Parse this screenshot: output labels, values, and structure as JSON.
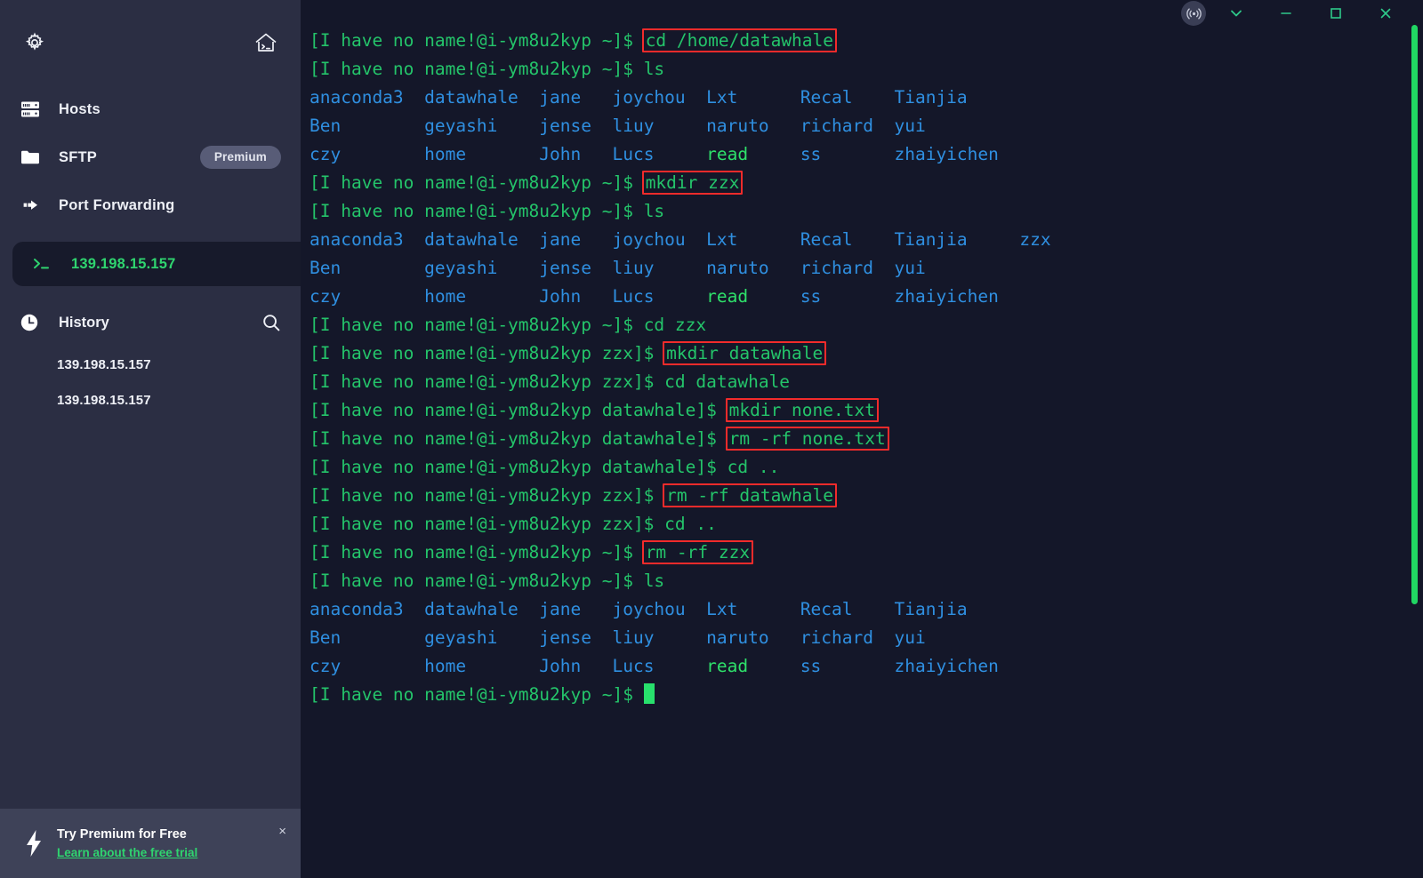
{
  "sidebar": {
    "top_icons": [
      {
        "name": "settings-gear-icon",
        "label": "Settings"
      },
      {
        "name": "home-terminal-icon",
        "label": "Home"
      }
    ],
    "items": [
      {
        "icon": "server-icon",
        "label": "Hosts",
        "badge": ""
      },
      {
        "icon": "folder-icon",
        "label": "SFTP",
        "badge": "Premium"
      },
      {
        "icon": "port-forwarding-icon",
        "label": "Port Forwarding",
        "badge": ""
      }
    ],
    "active_session": {
      "icon": "terminal-prompt-icon",
      "label": "139.198.15.157"
    },
    "history": {
      "icon": "clock-icon",
      "label": "History",
      "search_icon": "search-icon",
      "entries": [
        "139.198.15.157",
        "139.198.15.157"
      ]
    },
    "promo": {
      "icon": "lightning-bolt-icon",
      "title": "Try Premium for Free",
      "link": "Learn about the free trial",
      "close": "×"
    }
  },
  "titlebar": {
    "buttons": [
      {
        "name": "broadcast-icon",
        "glyph": "broadcast"
      },
      {
        "name": "chevron-down-icon",
        "glyph": "chevron"
      },
      {
        "name": "minimize-button",
        "glyph": "minimize"
      },
      {
        "name": "maximize-button",
        "glyph": "maximize"
      },
      {
        "name": "close-button",
        "glyph": "close"
      }
    ]
  },
  "terminal": {
    "prompt_home": "[I have no name!@i-ym8u2kyp ~]$ ",
    "prompt_zzx": "[I have no name!@i-ym8u2kyp zzx]$ ",
    "prompt_dw": "[I have no name!@i-ym8u2kyp datawhale]$ ",
    "commands": {
      "cd_home": "cd /home/datawhale",
      "ls": "ls",
      "mkdir_zzx": "mkdir zzx",
      "cd_zzx": "cd zzx",
      "mkdir_datawhale": "mkdir datawhale",
      "cd_datawhale": "cd datawhale",
      "mkdir_none": "mkdir none.txt",
      "rm_none": "rm -rf none.txt",
      "cd_up": "cd ..",
      "rm_datawhale": "rm -rf datawhale",
      "rm_zzx": "rm -rf zzx"
    },
    "ls_rows_plain": [
      [
        "anaconda3",
        "datawhale",
        "jane",
        "joychou",
        "Lxt",
        "Recal",
        "Tianjia"
      ],
      [
        "Ben",
        "geyashi",
        "jense",
        "liuy",
        "naruto",
        "richard",
        "yui"
      ],
      [
        "czy",
        "home",
        "John",
        "Lucs",
        "read",
        "ss",
        "zhaiyichen"
      ]
    ],
    "ls_rows_with_zzx": [
      [
        "anaconda3",
        "datawhale",
        "jane",
        "joychou",
        "Lxt",
        "Recal",
        "Tianjia",
        "zzx"
      ],
      [
        "Ben",
        "geyashi",
        "jense",
        "liuy",
        "naruto",
        "richard",
        "yui",
        ""
      ],
      [
        "czy",
        "home",
        "John",
        "Lucs",
        "read",
        "ss",
        "zhaiyichen",
        ""
      ]
    ],
    "executables": [
      "read"
    ],
    "cursor": "block"
  },
  "colors": {
    "sidebar_bg": "#2b2e43",
    "terminal_bg": "#141729",
    "prompt_green": "#24c46a",
    "dir_blue": "#2f8fe0",
    "exe_green": "#2ee06a",
    "highlight_red": "#f22b2b",
    "accent_green": "#2fd46f",
    "scrollbar": "#21d663"
  }
}
